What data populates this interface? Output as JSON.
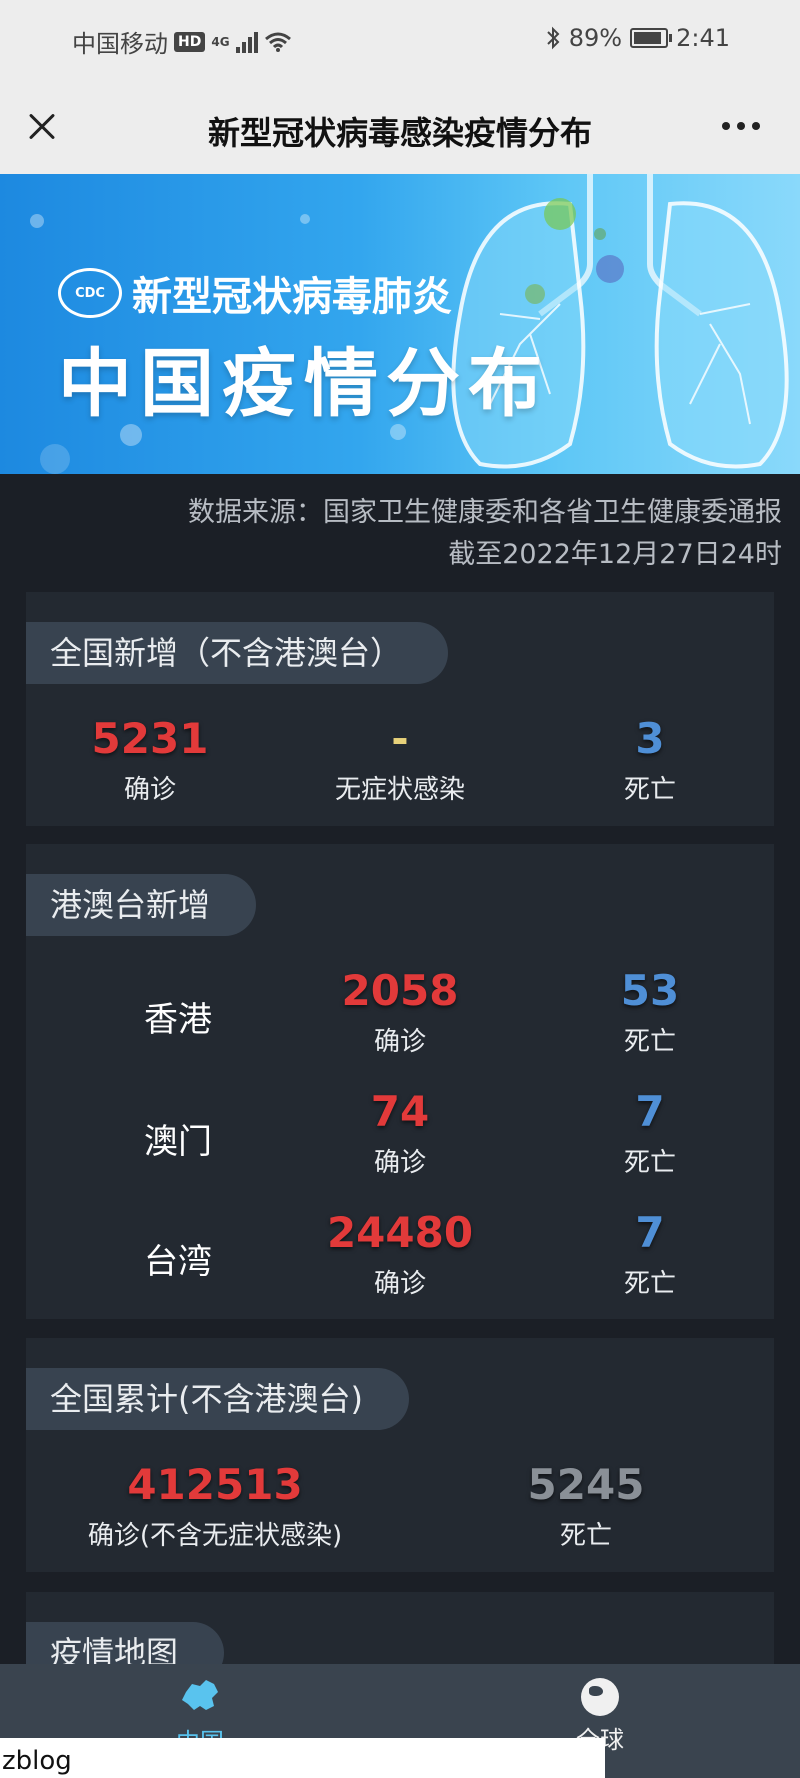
{
  "status_bar": {
    "carrier": "中国移动",
    "hd": "HD",
    "network": "4G",
    "battery": "89%",
    "time": "2:41"
  },
  "header": {
    "title": "新型冠状病毒感染疫情分布"
  },
  "banner": {
    "logo_text": "CDC",
    "subtitle": "新型冠状病毒肺炎",
    "title": "中国疫情分布"
  },
  "source": {
    "line1": "数据来源：国家卫生健康委和各省卫生健康委通报",
    "line2": "截至2022年12月27日24时"
  },
  "national_new": {
    "heading": "全国新增（不含港澳台）",
    "confirmed": "5231",
    "confirmed_label": "确诊",
    "asymptomatic": "-",
    "asymptomatic_label": "无症状感染",
    "deaths": "3",
    "deaths_label": "死亡"
  },
  "hmt_new": {
    "heading": "港澳台新增",
    "rows": [
      {
        "region": "香港",
        "confirmed": "2058",
        "confirmed_label": "确诊",
        "deaths": "53",
        "deaths_label": "死亡"
      },
      {
        "region": "澳门",
        "confirmed": "74",
        "confirmed_label": "确诊",
        "deaths": "7",
        "deaths_label": "死亡"
      },
      {
        "region": "台湾",
        "confirmed": "24480",
        "confirmed_label": "确诊",
        "deaths": "7",
        "deaths_label": "死亡"
      }
    ]
  },
  "national_total": {
    "heading": "全国累计(不含港澳台)",
    "confirmed": "412513",
    "confirmed_label": "确诊(不含无症状感染)",
    "deaths": "5245",
    "deaths_label": "死亡"
  },
  "map_section": {
    "heading": "疫情地图"
  },
  "bottom_nav": {
    "china_label": "中国",
    "global_label": "全球"
  },
  "watermark": "zblog",
  "colors": {
    "confirmed": "#e23a3a",
    "deaths": "#4f8fd6",
    "total_deaths": "#8a9097",
    "active_tab": "#59c3ee"
  }
}
